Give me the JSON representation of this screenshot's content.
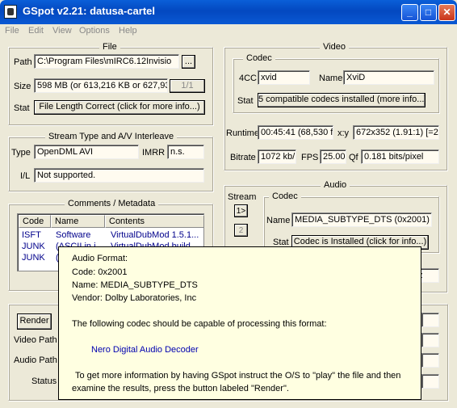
{
  "window": {
    "title": "GSpot v2.21: datusa-cartel",
    "minimize": "_",
    "maximize": "□",
    "close": "✕"
  },
  "menu": [
    "File",
    "Edit",
    "View",
    "Options",
    "Help"
  ],
  "file": {
    "group": "File",
    "path_label": "Path",
    "path": "C:\\Program Files\\mIRC6.12Invisio",
    "browse": "...",
    "size_label": "Size",
    "size": "598 MB (or 613,216 KB or 627,93",
    "page": "1/1",
    "stat_label": "Stat",
    "stat": "File Length Correct (click for more info...)"
  },
  "stream": {
    "group": "Stream Type and A/V Interleave",
    "type_label": "Type",
    "type": "OpenDML AVI",
    "imrr_label": "IMRR",
    "imrr": "n.s.",
    "il_label": "I/L",
    "il": "Not supported."
  },
  "comments": {
    "group": "Comments / Metadata",
    "headers": [
      "Code",
      "Name",
      "Contents"
    ],
    "rows": [
      [
        "ISFT",
        "Software",
        "VirtualDubMod 1.5.1..."
      ],
      [
        "JUNK",
        "(ASCII in i",
        "VirtualDubMod build"
      ],
      [
        "JUNK",
        "(",
        ""
      ]
    ]
  },
  "video": {
    "group": "Video",
    "codec_group": "Codec",
    "fourcc_label": "4CC",
    "fourcc": "xvid",
    "name_label": "Name",
    "name": "XviD",
    "stat_label": "Stat",
    "stat": "5 compatible codecs installed (more info...)",
    "runtime_label": "Runtime",
    "runtime": "00:45:41 (68,530 fr",
    "xy_label": "x:y",
    "xy": "672x352 (1.91:1) [=21",
    "bitrate_label": "Bitrate",
    "bitrate": "1072 kb/",
    "fps_label": "FPS",
    "fps": "25.00",
    "qf_label": "Qf",
    "qf": "0.181 bits/pixel"
  },
  "audio": {
    "group": "Audio",
    "stream_label": "Stream",
    "stream1": "1>",
    "stream2": "2",
    "codec_group": "Codec",
    "name_label": "Name",
    "name": "MEDIA_SUBTYPE_DTS (0x2001)",
    "stat_label": "Stat",
    "stat": "Codec is Installed (click for info...)",
    "partial": "z"
  },
  "render": {
    "render_btn": "Render",
    "video_path_label": "Video Path",
    "audio_path_label": "Audio Path",
    "status_label": "Status"
  },
  "tooltip": {
    "lines": [
      "Audio Format:",
      "Code: 0x2001",
      "Name: MEDIA_SUBTYPE_DTS",
      "Vendor: Dolby Laboratories, Inc"
    ],
    "capable": "The following codec should be capable of processing this format:",
    "codec": "Nero Digital Audio Decoder",
    "info1": "To get more information by having GSpot instruct the O/S to \"play\" the file and then",
    "info2": "examine the results,  press the button labeled \"Render\"."
  }
}
